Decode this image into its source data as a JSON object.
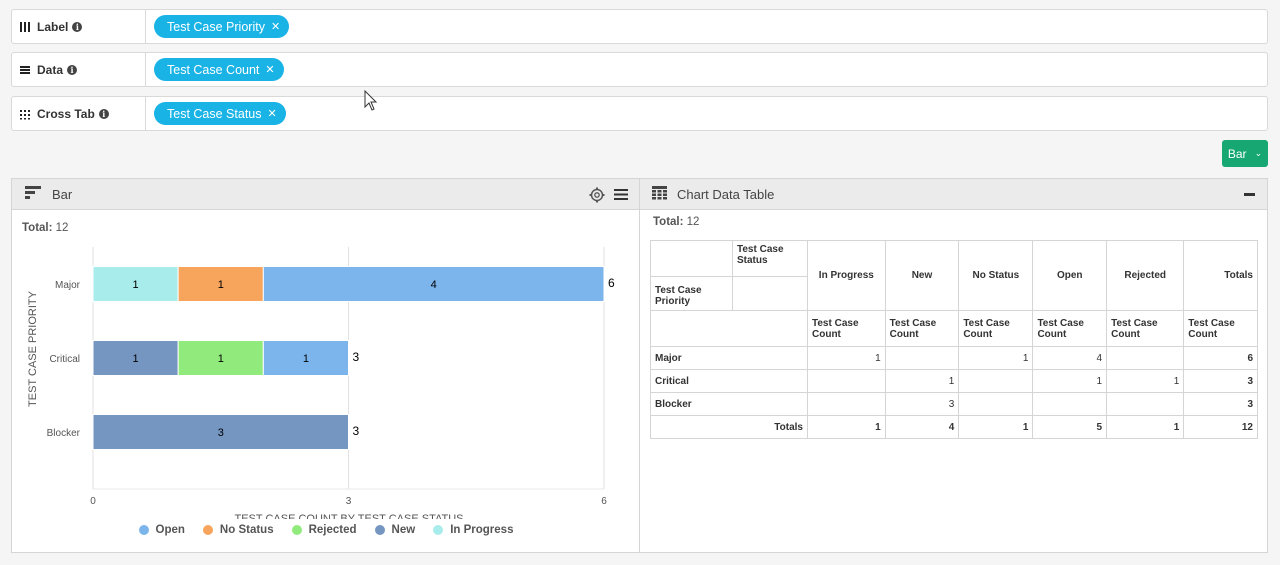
{
  "config": {
    "label_row": {
      "title": "Label",
      "chip": "Test Case Priority"
    },
    "data_row": {
      "title": "Data",
      "chip": "Test Case Count"
    },
    "crosstab_row": {
      "title": "Cross Tab",
      "chip": "Test Case Status"
    }
  },
  "chart_type_button": "Bar",
  "chart_panel": {
    "title": "Bar",
    "total_label": "Total:",
    "total_value": "12"
  },
  "table_panel": {
    "title": "Chart Data Table",
    "total_label": "Total:",
    "total_value": "12"
  },
  "chart_data": {
    "type": "bar",
    "orientation": "horizontal",
    "stacked": true,
    "categories": [
      "Major",
      "Critical",
      "Blocker"
    ],
    "series": [
      {
        "name": "In Progress",
        "color": "#a8ecec",
        "values": [
          1,
          0,
          0
        ]
      },
      {
        "name": "No Status",
        "color": "#f7a45c",
        "values": [
          1,
          0,
          0
        ]
      },
      {
        "name": "New",
        "color": "#7496c1",
        "values": [
          0,
          1,
          3
        ]
      },
      {
        "name": "Rejected",
        "color": "#91ea7c",
        "values": [
          0,
          1,
          0
        ]
      },
      {
        "name": "Open",
        "color": "#7cb5ec",
        "values": [
          4,
          1,
          0
        ]
      }
    ],
    "totals": [
      6,
      3,
      3
    ],
    "xlabel": "TEST CASE COUNT BY TEST CASE STATUS",
    "ylabel": "TEST CASE PRIORITY",
    "xlim": [
      0,
      6
    ],
    "xticks": [
      "0",
      "3",
      "6"
    ],
    "legend_position": "bottom",
    "legend_order": [
      "Open",
      "No Status",
      "Rejected",
      "New",
      "In Progress"
    ]
  },
  "data_table": {
    "corner_top": "Test Case Status",
    "corner_bottom": "Test Case Priority",
    "columns": [
      "In Progress",
      "New",
      "No Status",
      "Open",
      "Rejected",
      "Totals"
    ],
    "subheader": "Test Case Count",
    "rows": [
      {
        "label": "Major",
        "values": [
          "1",
          "",
          "1",
          "4",
          "",
          "6"
        ]
      },
      {
        "label": "Critical",
        "values": [
          "",
          "1",
          "",
          "1",
          "1",
          "3"
        ]
      },
      {
        "label": "Blocker",
        "values": [
          "",
          "3",
          "",
          "",
          "",
          "3"
        ]
      }
    ],
    "totals_row": {
      "label": "Totals",
      "values": [
        "1",
        "4",
        "1",
        "5",
        "1",
        "12"
      ]
    }
  }
}
